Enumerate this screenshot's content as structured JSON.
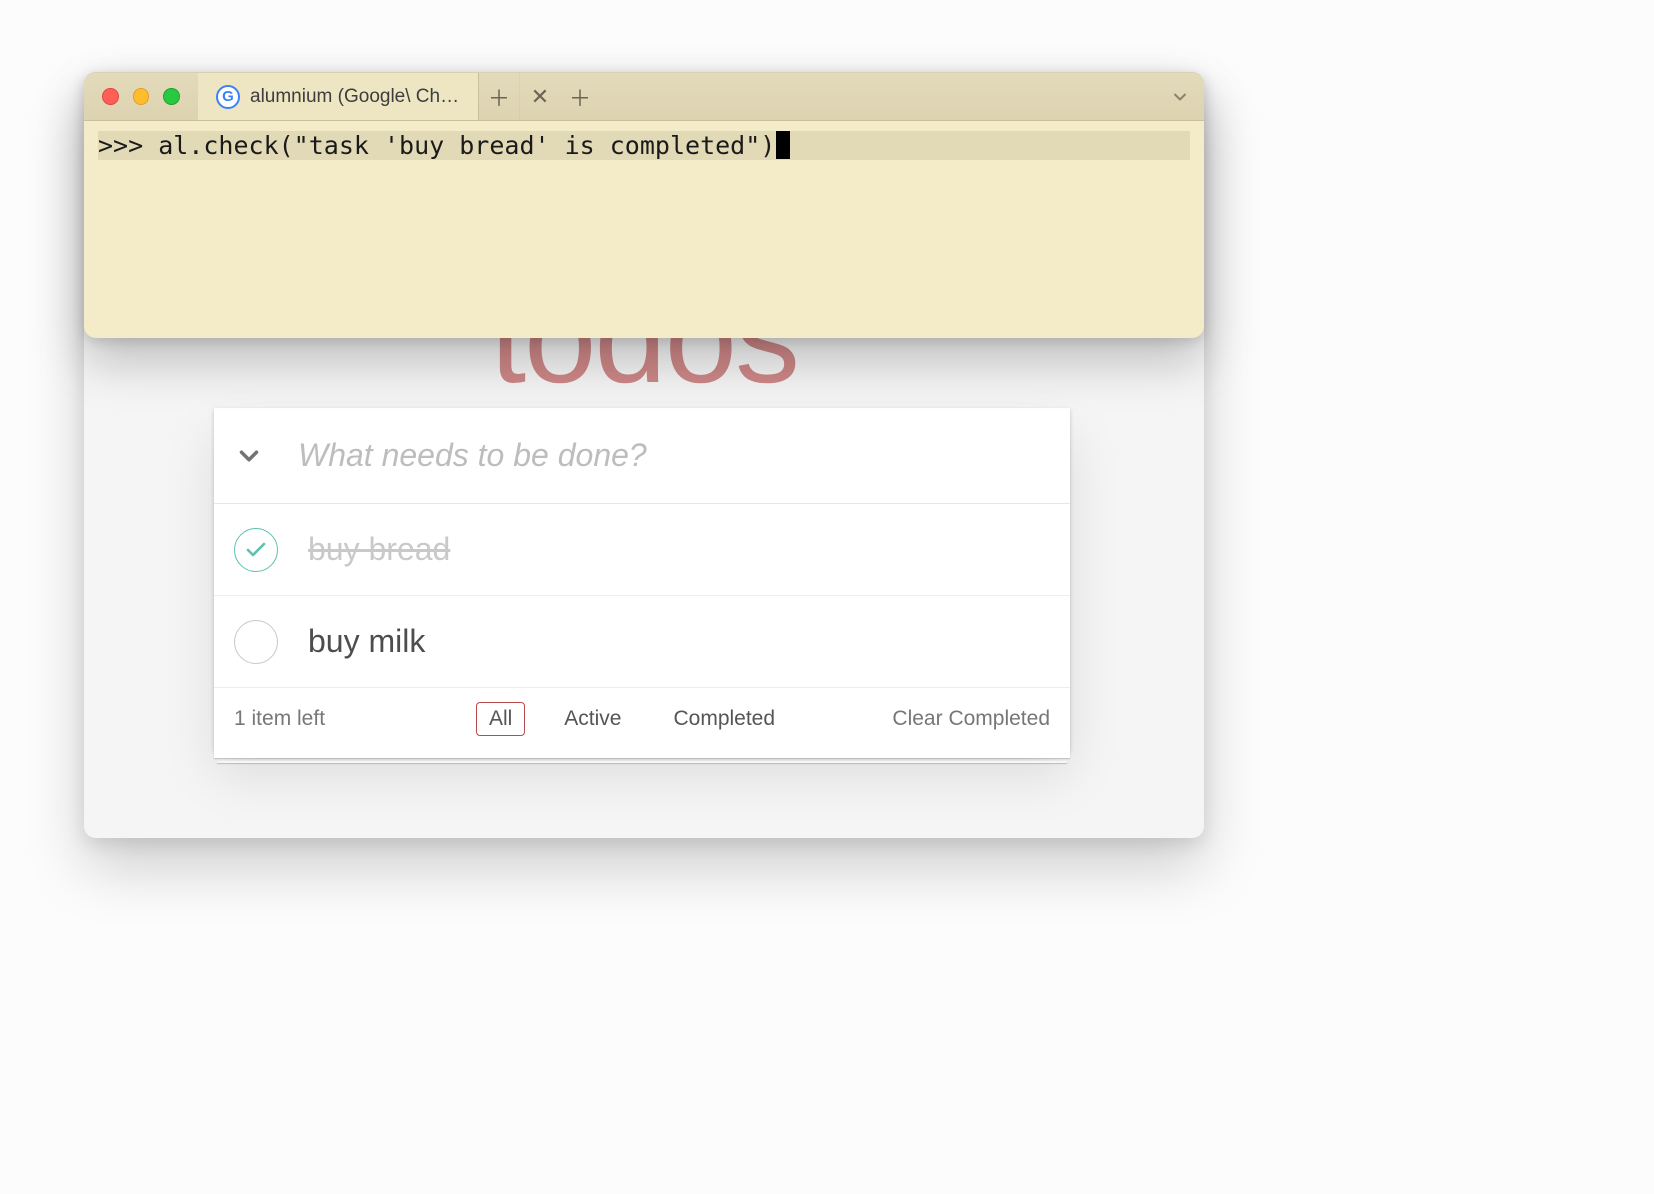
{
  "terminal": {
    "tab_title": "alumnium (Google\\ Chrom...",
    "prompt": ">>> ",
    "command": "al.check(\"task 'buy bread' is completed\")"
  },
  "app": {
    "title": "todos",
    "input_placeholder": "What needs to be done?",
    "items": [
      {
        "label": "buy bread",
        "completed": true
      },
      {
        "label": "buy milk",
        "completed": false
      }
    ],
    "count_text": "1 item left",
    "filters": {
      "all": "All",
      "active": "Active",
      "completed": "Completed",
      "selected": "all"
    },
    "clear_label": "Clear Completed"
  }
}
